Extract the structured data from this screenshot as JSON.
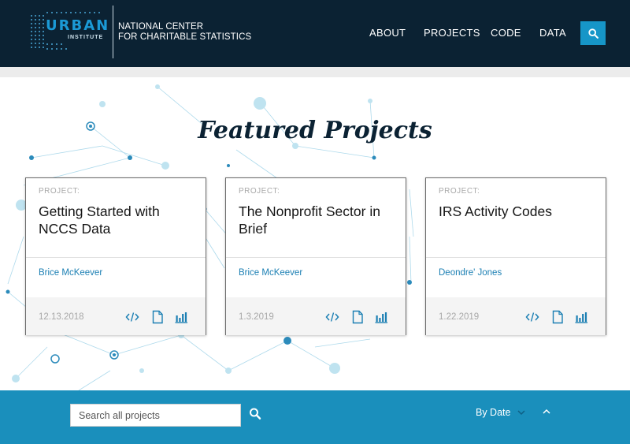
{
  "header": {
    "logo_word": "URBAN",
    "logo_sub": "INSTITUTE",
    "center_line1": "NATIONAL CENTER",
    "center_line2": "FOR CHARITABLE STATISTICS",
    "nav": [
      "ABOUT",
      "PROJECTS",
      "CODE",
      "DATA"
    ],
    "search_icon": "search-icon"
  },
  "main": {
    "title": "Featured Projects",
    "cards": [
      {
        "eyebrow": "PROJECT:",
        "title": "Getting Started with NCCS Data",
        "author": "Brice McKeever",
        "date": "12.13.2018"
      },
      {
        "eyebrow": "PROJECT:",
        "title": "The Nonprofit Sector in Brief",
        "author": "Brice McKeever",
        "date": "1.3.2019"
      },
      {
        "eyebrow": "PROJECT:",
        "title": "IRS Activity Codes",
        "author": "Deondre' Jones",
        "date": "1.22.2019"
      }
    ],
    "card_icons": [
      "code-icon",
      "document-icon",
      "bar-chart-icon"
    ]
  },
  "footer": {
    "search_placeholder": "Search all projects",
    "sort_label": "By Date"
  },
  "colors": {
    "header_bg": "#0b2233",
    "accent": "#1696c8",
    "footer_bg": "#1a8fbc",
    "link": "#1b7fb3"
  }
}
